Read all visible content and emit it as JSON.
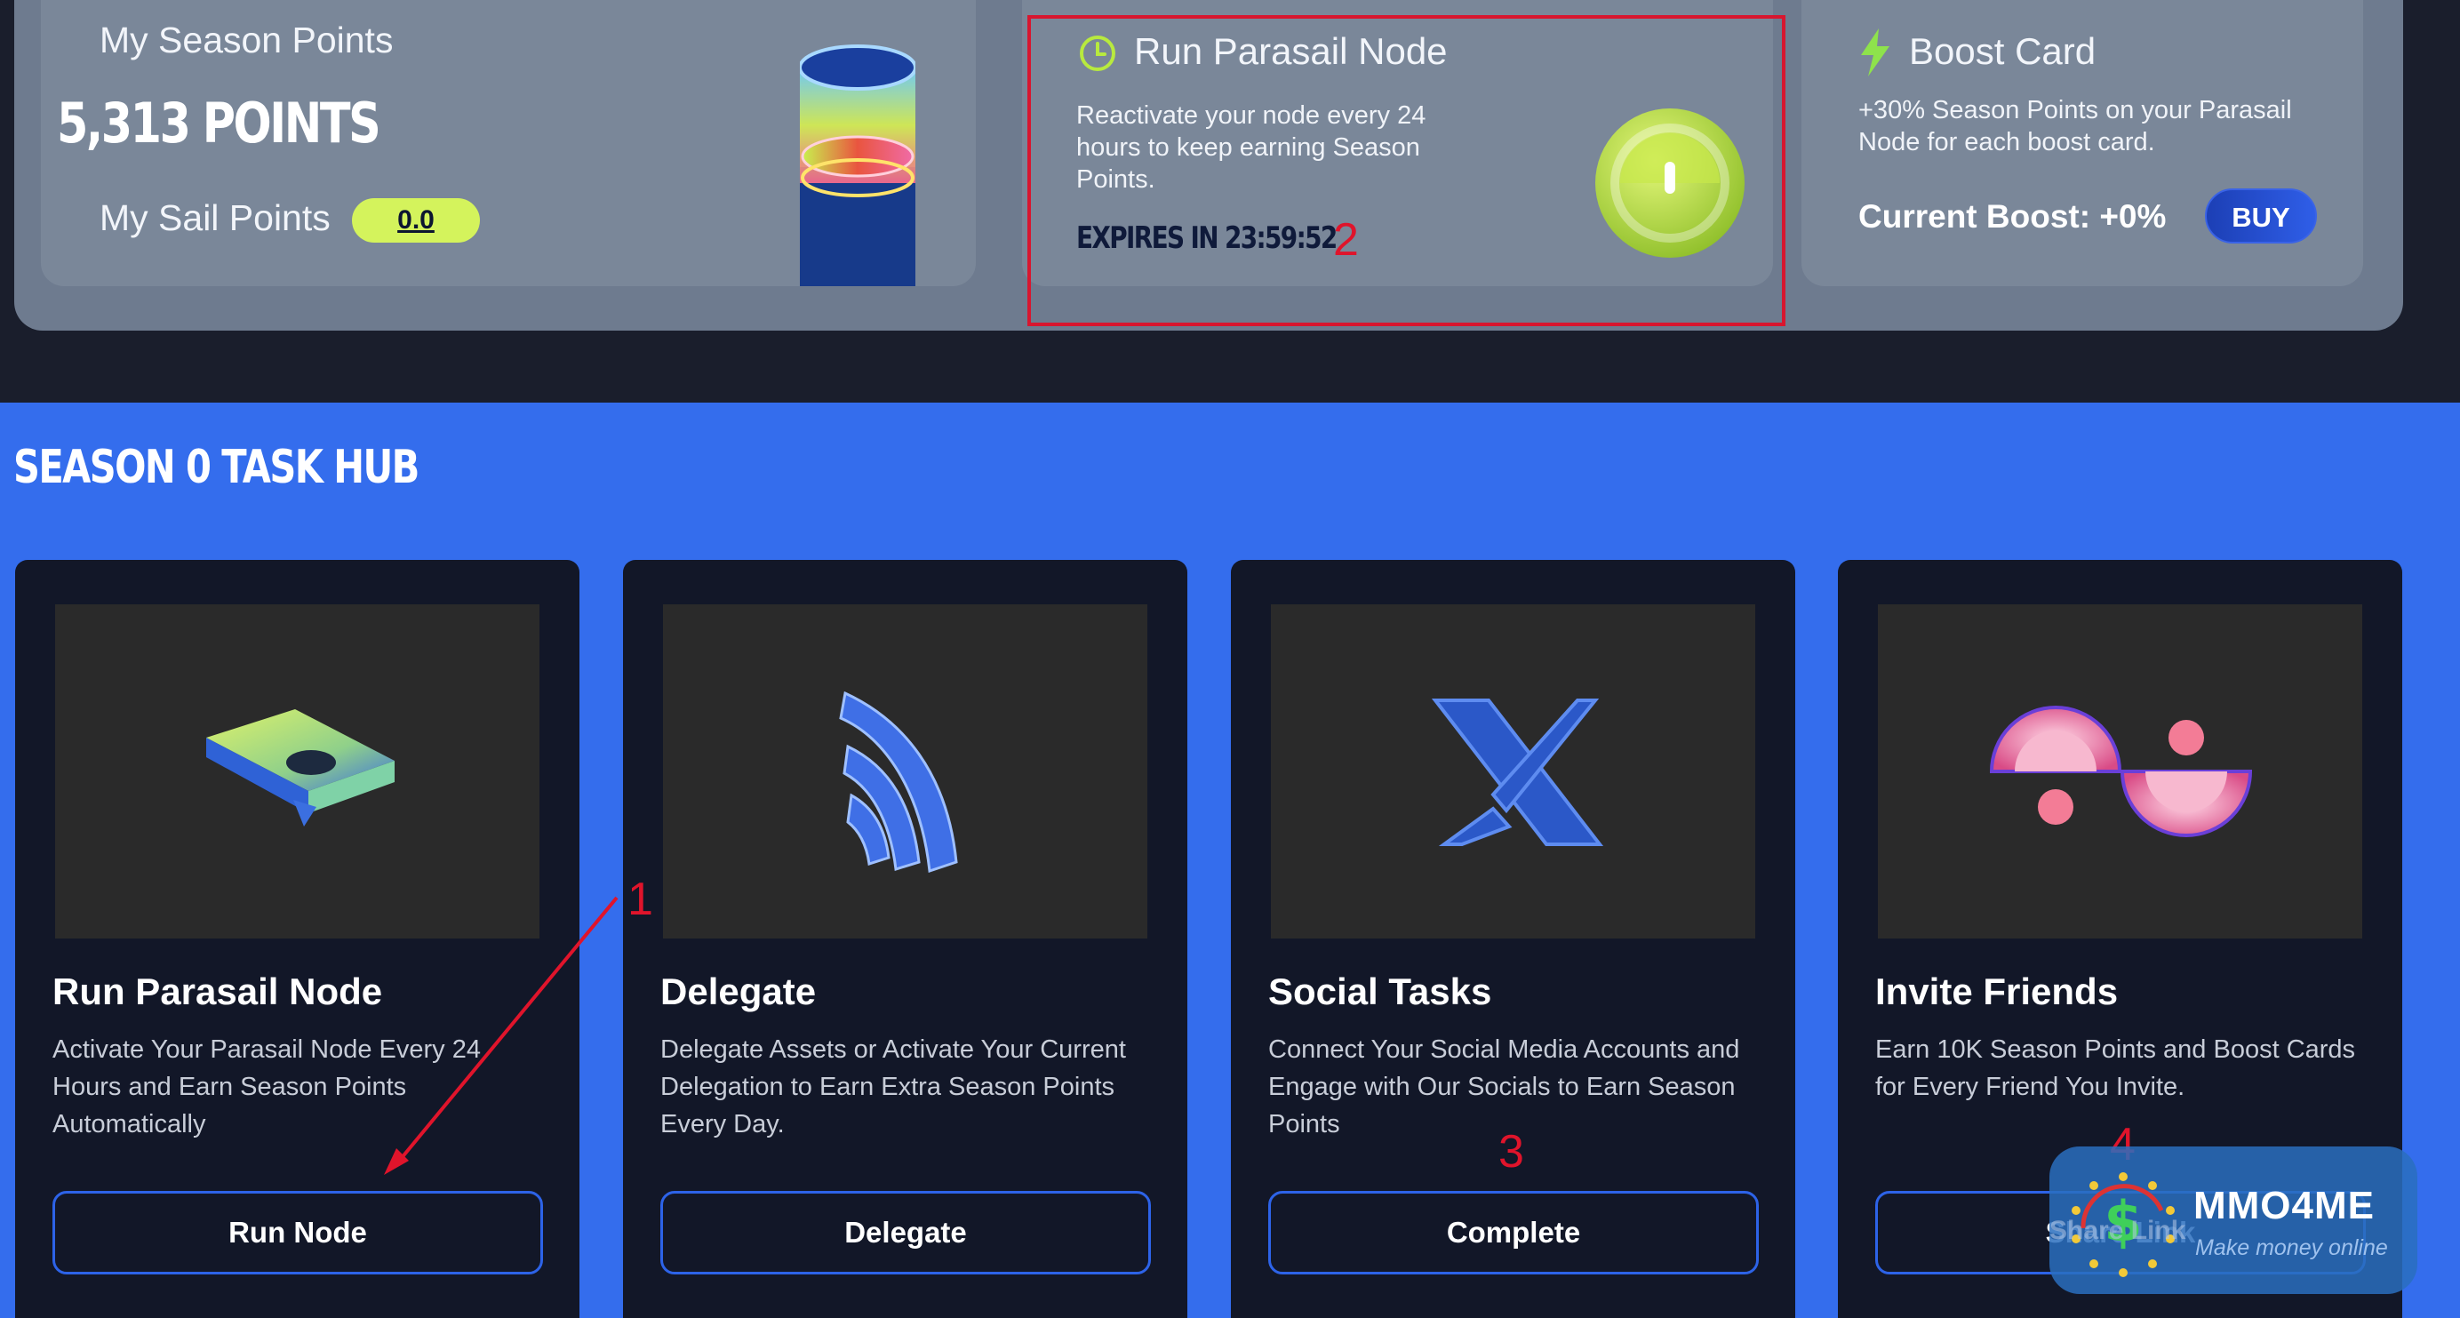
{
  "season": {
    "title": "My Season Points",
    "points": "5,313 POINTS",
    "sail_label": "My Sail Points",
    "sail_value": "0.0"
  },
  "node": {
    "title": "Run Parasail Node",
    "description": "Reactivate your node every 24 hours to keep earning Season Points.",
    "expires": "EXPIRES IN 23:59:52"
  },
  "boost": {
    "title": "Boost Card",
    "description": "+30% Season Points on your Parasail Node for each boost card.",
    "current": "Current Boost: +0%",
    "buy_label": "BUY"
  },
  "hub": {
    "title": "SEASON 0 TASK HUB",
    "tasks": [
      {
        "title": "Run Parasail Node",
        "description": "Activate Your Parasail Node Every 24 Hours and Earn Season Points Automatically",
        "button": "Run Node"
      },
      {
        "title": "Delegate",
        "description": "Delegate Assets or Activate Your Current Delegation to Earn Extra Season Points Every Day.",
        "button": "Delegate"
      },
      {
        "title": "Social Tasks",
        "description": "Connect Your Social Media Accounts and Engage with Our Socials to Earn Season Points",
        "button": "Complete"
      },
      {
        "title": "Invite Friends",
        "description": "Earn 10K Season Points and Boost Cards for Every Friend You Invite.",
        "button": "Share Link"
      }
    ]
  },
  "annotations": {
    "n1": "1",
    "n2": "2",
    "n3": "3",
    "n4": "4"
  },
  "watermark": {
    "title": "MMO4ME",
    "subtitle": "Make money online"
  },
  "colors": {
    "accent_lime": "#d4f35c",
    "hub_blue": "#346ded",
    "annotation_red": "#e0142b"
  }
}
